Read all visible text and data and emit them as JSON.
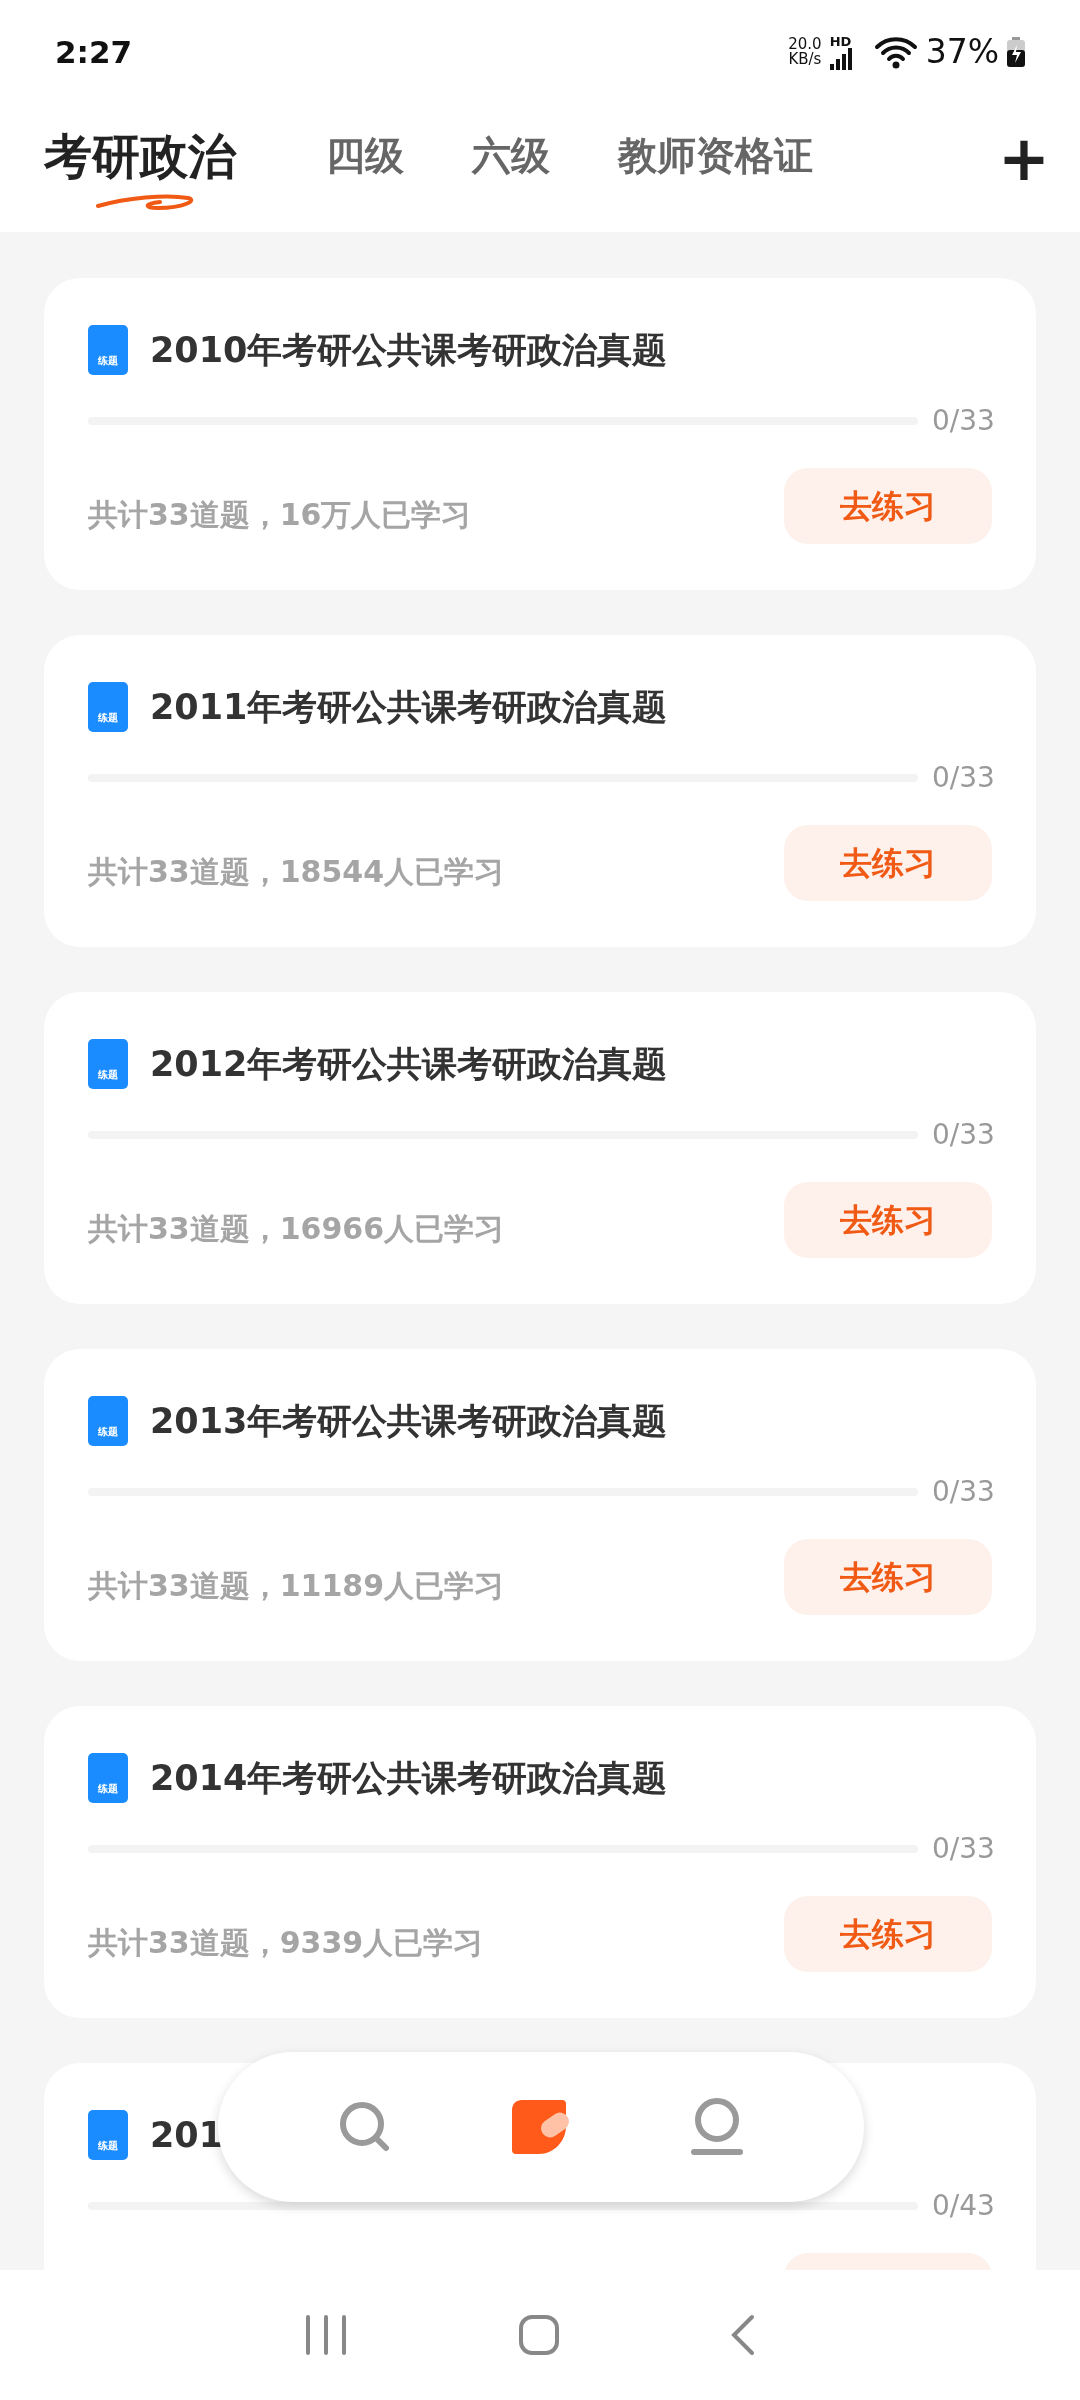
{
  "status_bar": {
    "time": "2:27",
    "net_speed": "20.0",
    "net_unit": "KB/s",
    "net_type": "HD",
    "battery": "37%"
  },
  "tabs": [
    {
      "label": "考研政治",
      "selected": true
    },
    {
      "label": "四级",
      "selected": false
    },
    {
      "label": "六级",
      "selected": false
    },
    {
      "label": "教师资格证",
      "selected": false
    }
  ],
  "add_button": "+",
  "cards": [
    {
      "badge": "练题",
      "title": "2010年考研公共课考研政治真题",
      "level": 0,
      "progress": "0/33",
      "stats": "共计33道题，16万人已学习",
      "button": "去练习"
    },
    {
      "badge": "练题",
      "title": "2011年考研公共课考研政治真题",
      "level": 0,
      "progress": "0/33",
      "stats": "共计33道题，18544人已学习",
      "button": "去练习"
    },
    {
      "badge": "练题",
      "title": "2012年考研公共课考研政治真题",
      "level": 0,
      "progress": "0/33",
      "stats": "共计33道题，16966人已学习",
      "button": "去练习"
    },
    {
      "badge": "练题",
      "title": "2013年考研公共课考研政治真题",
      "level": 0,
      "progress": "0/33",
      "stats": "共计33道题，11189人已学习",
      "button": "去练习"
    },
    {
      "badge": "练题",
      "title": "2014年考研公共课考研政治真题",
      "level": 0,
      "progress": "0/33",
      "stats": "共计33道题，9339人已学习",
      "button": "去练习"
    },
    {
      "badge": "练题",
      "title": "201",
      "level": 0,
      "progress": "0/43"
    }
  ],
  "bottom_nav": [
    {
      "kind": "search",
      "selected": false
    },
    {
      "kind": "practice",
      "selected": true
    },
    {
      "kind": "profile",
      "selected": false
    }
  ]
}
